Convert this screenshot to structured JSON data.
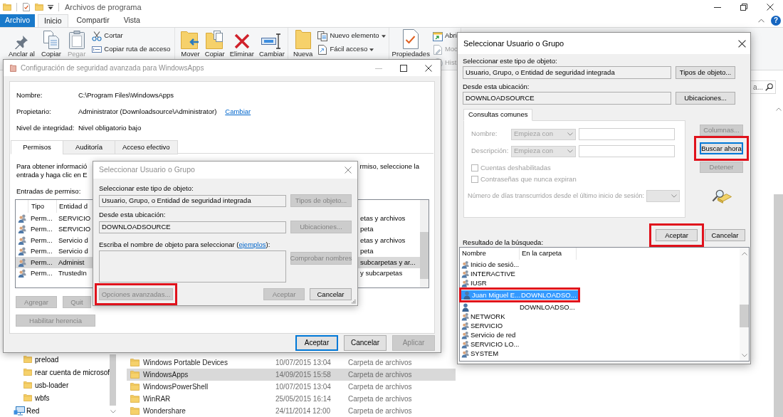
{
  "explorer": {
    "title": "Archivos de programa",
    "help_button": "?",
    "ribbon_tabs": [
      {
        "label": "Archivo",
        "kind": "menu",
        "selected": false
      },
      {
        "label": "Inicio",
        "kind": "tab",
        "selected": true
      },
      {
        "label": "Compartir",
        "kind": "tab",
        "selected": false
      },
      {
        "label": "Vista",
        "kind": "tab",
        "selected": false
      }
    ],
    "ribbon_groups": [
      {
        "items": [
          {
            "kind": "large",
            "label": "Anclar al",
            "disabled": false
          },
          {
            "kind": "large",
            "label": "Copiar",
            "disabled": false
          },
          {
            "kind": "large",
            "label": "Pegar",
            "disabled": true
          },
          {
            "kind": "small",
            "label": "Cortar",
            "disabled": false
          },
          {
            "kind": "small",
            "label": "Copiar ruta de acceso",
            "disabled": false
          }
        ]
      },
      {
        "items": [
          {
            "kind": "large",
            "label": "Mover",
            "disabled": false
          },
          {
            "kind": "large",
            "label": "Copiar",
            "disabled": false
          },
          {
            "kind": "large",
            "label": "Eliminar",
            "disabled": false
          },
          {
            "kind": "large",
            "label": "Cambiar",
            "disabled": false
          }
        ]
      },
      {
        "items": [
          {
            "kind": "large",
            "label": "Nueva",
            "disabled": false
          },
          {
            "kind": "menu",
            "label": "Nuevo elemento",
            "disabled": false
          },
          {
            "kind": "menu",
            "label": "Fácil acceso",
            "disabled": false
          }
        ]
      },
      {
        "items": [
          {
            "kind": "large",
            "label": "Propiedades",
            "disabled": false
          },
          {
            "kind": "small",
            "label": "Abri",
            "disabled": false
          },
          {
            "kind": "small",
            "label": "Moc",
            "disabled": true
          },
          {
            "kind": "small",
            "label": "Hist",
            "disabled": true
          }
        ]
      }
    ],
    "search": {
      "placeholder": "a..."
    },
    "nav_items": [
      {
        "label": "preload",
        "kind": "folder"
      },
      {
        "label": "rear cuenta de microsof",
        "kind": "folder"
      },
      {
        "label": "usb-loader",
        "kind": "folder"
      },
      {
        "label": "wbfs",
        "kind": "folder"
      },
      {
        "label": "Red",
        "kind": "network"
      }
    ],
    "files": [
      {
        "name": "Windows Portable Devices",
        "date": "10/07/2015 13:04",
        "type": "Carpeta de archivos",
        "selected": false
      },
      {
        "name": "WindowsApps",
        "date": "14/09/2015 15:58",
        "type": "Carpeta de archivos",
        "selected": true
      },
      {
        "name": "WindowsPowerShell",
        "date": "10/07/2015 13:04",
        "type": "Carpeta de archivos",
        "selected": false
      },
      {
        "name": "WinRAR",
        "date": "25/05/2015 16:14",
        "type": "Carpeta de archivos",
        "selected": false
      },
      {
        "name": "Wondershare",
        "date": "24/11/2014 12:00",
        "type": "Carpeta de archivos",
        "selected": false
      }
    ]
  },
  "security_window": {
    "title": "Configuración de seguridad avanzada para WindowsApps",
    "active": false,
    "fields": [
      {
        "label": "Nombre:",
        "value": "C:\\Program Files\\WindowsApps"
      },
      {
        "label": "Propietario:",
        "value": "Administrator (Downloadsource\\Administrator)",
        "link": "Cambiar"
      },
      {
        "label": "Nivel de integridad:",
        "value": "Nivel obligatorio bajo"
      }
    ],
    "tabs": [
      {
        "label": "Permisos",
        "selected": true
      },
      {
        "label": "Auditoría",
        "selected": false
      },
      {
        "label": "Acceso efectivo",
        "selected": false
      }
    ],
    "description_left": [
      "Para obtener informació",
      "entrada y haga clic en E"
    ],
    "description_right": [
      "rmiso, seleccione la"
    ],
    "entries_label": "Entradas de permiso:",
    "columns": [
      "Tipo",
      "Entidad d"
    ],
    "entries": [
      {
        "type": "Perm...",
        "entity": "SERVICIO",
        "column_3": "etas y archivos",
        "selected": false
      },
      {
        "type": "Perm...",
        "entity": "SERVICIO",
        "column_3": "peta",
        "selected": false
      },
      {
        "type": "Perm...",
        "entity": "Servicio d",
        "column_3": "etas y archivos",
        "selected": false
      },
      {
        "type": "Perm...",
        "entity": "Servicio d",
        "column_3": "peta",
        "selected": false
      },
      {
        "type": "Perm...",
        "entity": "Administ",
        "column_3": "subcarpetas y ar...",
        "selected": true
      },
      {
        "type": "Perm...",
        "entity": "TrustedIn",
        "column_3": "y subcarpetas",
        "selected": false
      }
    ],
    "entry_buttons": [
      {
        "label": "Agregar",
        "disabled": true
      },
      {
        "label": "Quit",
        "disabled": true
      }
    ],
    "inherit_button": {
      "label": "Habilitar herencia",
      "disabled": true
    },
    "footer_buttons": [
      {
        "label": "Aceptar",
        "default": true,
        "disabled": false
      },
      {
        "label": "Cancelar",
        "default": false,
        "disabled": false
      },
      {
        "label": "Aplicar",
        "default": false,
        "disabled": true
      }
    ]
  },
  "back_select_dialog": {
    "title": "Seleccionar Usuario o Grupo",
    "active": false,
    "object_type_label": "Seleccionar este tipo de objeto:",
    "object_type": "Usuario, Grupo, o Entidad de seguridad integrada",
    "object_types_button": {
      "label": "Tipos de objeto...",
      "disabled": true
    },
    "location_label": "Desde esta ubicación:",
    "location": "DOWNLOADSOURCE",
    "locations_button": {
      "label": "Ubicaciones...",
      "disabled": true
    },
    "names_label": "Escriba el nombre de objeto para seleccionar (",
    "names_link": "ejemplos",
    "names_label_end": "):",
    "check_names_button": {
      "label": "Comprobar nombres",
      "disabled": true
    },
    "advanced_button": {
      "label": "Opciones avanzadas...",
      "disabled": true,
      "highlighted": true
    },
    "ok_button": {
      "label": "Aceptar",
      "disabled": true
    },
    "cancel_button": {
      "label": "Cancelar",
      "disabled": false
    }
  },
  "front_select_dialog": {
    "title": "Seleccionar Usuario o Grupo",
    "active": true,
    "object_type_label": "Seleccionar este tipo de objeto:",
    "object_type": "Usuario, Grupo, o Entidad de seguridad integrada",
    "object_types_button": {
      "label": "Tipos de objeto...",
      "disabled": false
    },
    "location_label": "Desde esta ubicación:",
    "location": "DOWNLOADSOURCE",
    "locations_button": {
      "label": "Ubicaciones...",
      "disabled": false
    },
    "query_tab": {
      "label": "Consultas comunes",
      "selected": true
    },
    "query": {
      "disabled": true,
      "fields": [
        {
          "label": "Nombre:",
          "mode": "Empieza con"
        },
        {
          "label": "Descripción:",
          "mode": "Empieza con"
        }
      ],
      "checkboxes": [
        {
          "label": "Cuentas deshabilitadas",
          "checked": false
        },
        {
          "label": "Contraseñas que nunca expiran",
          "checked": false
        }
      ],
      "days_label": "Número de días transcurridos desde el último inicio de sesión:"
    },
    "columns_button": {
      "label": "Columnas...",
      "disabled": true
    },
    "search_button": {
      "label": "Buscar ahora",
      "disabled": false,
      "default": true,
      "highlighted": true
    },
    "stop_button": {
      "label": "Detener",
      "disabled": true
    },
    "ok_button": {
      "label": "Aceptar",
      "disabled": false,
      "highlighted": true
    },
    "cancel_button": {
      "label": "Cancelar",
      "disabled": false
    },
    "results_label": "Resultado de la búsqueda:",
    "results_columns": [
      "Nombre",
      "En la carpeta"
    ],
    "results": [
      {
        "kind": "group",
        "name": "Inicio de sesió...",
        "selected": false,
        "highlighted": false
      },
      {
        "kind": "group",
        "name": "INTERACTIVE",
        "selected": false,
        "highlighted": false
      },
      {
        "kind": "group",
        "name": "IUSR",
        "selected": false,
        "highlighted": false
      },
      {
        "kind": "user",
        "name": "Juan Miguel E...",
        "folder": "DOWNLOADSO...",
        "selected": true,
        "highlighted": true
      },
      {
        "kind": "user",
        "folder": "DOWNLOADSO...",
        "selected": false,
        "highlighted": false
      },
      {
        "kind": "group",
        "name": "NETWORK",
        "selected": false,
        "highlighted": false
      },
      {
        "kind": "group",
        "name": "SERVICIO",
        "selected": false,
        "highlighted": false
      },
      {
        "kind": "group",
        "name": "Servicio de red",
        "selected": false,
        "highlighted": false
      },
      {
        "kind": "group",
        "name": "SERVICIO LO...",
        "selected": false,
        "highlighted": false
      },
      {
        "kind": "group",
        "name": "SYSTEM",
        "selected": false,
        "highlighted": false
      }
    ]
  }
}
